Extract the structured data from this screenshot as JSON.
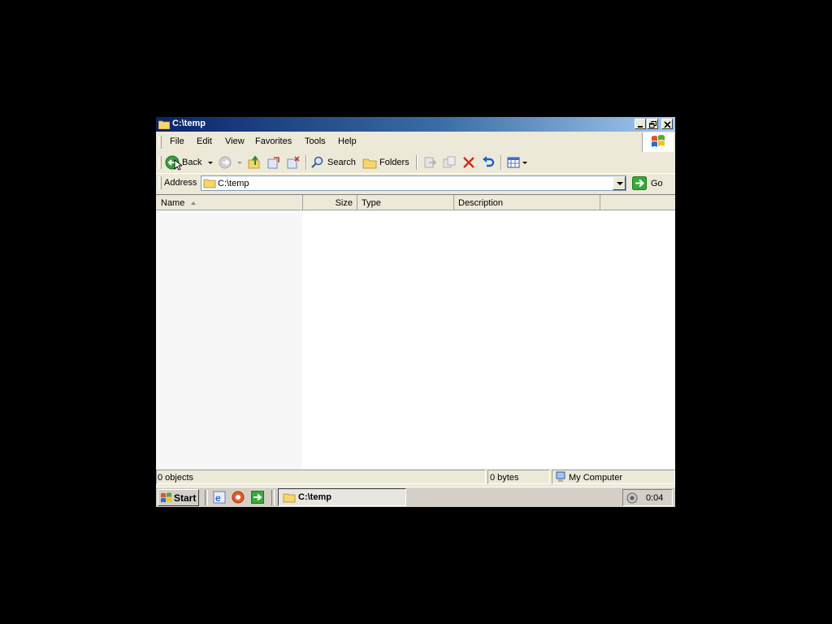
{
  "window": {
    "title": "C:\\temp",
    "controls": [
      "minimize",
      "restore",
      "close"
    ]
  },
  "menu": {
    "items": [
      "File",
      "Edit",
      "View",
      "Favorites",
      "Tools",
      "Help"
    ]
  },
  "toolbar": {
    "back_label": "Back",
    "search_label": "Search",
    "folders_label": "Folders",
    "icons": [
      "back-icon",
      "forward-icon",
      "up-folder-icon",
      "move-to-icon",
      "copy-to-icon",
      "search-icon",
      "folders-icon",
      "move-icon",
      "copy-icon",
      "delete-icon",
      "undo-icon",
      "views-icon"
    ]
  },
  "address": {
    "label": "Address",
    "value": "C:\\temp",
    "go_label": "Go"
  },
  "list": {
    "columns": [
      "Name",
      "Size",
      "Type",
      "Description"
    ],
    "sorted_by": "Name",
    "rows": []
  },
  "status": {
    "objects": "0 objects",
    "bytes": "0 bytes",
    "zone": "My Computer"
  },
  "taskbar": {
    "start_label": "Start",
    "quick_launch": [
      "ie-icon",
      "media-icon",
      "run-icon"
    ],
    "task_label": "C:\\temp",
    "clock": "0:04"
  },
  "colors": {
    "title_start": "#0a246a",
    "title_end": "#a6caf0",
    "face": "#ece9d8",
    "desktop": "#000000"
  }
}
